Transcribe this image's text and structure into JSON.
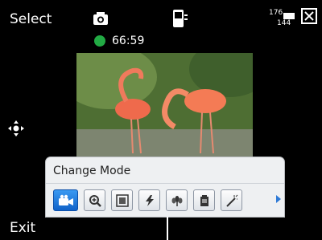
{
  "softkeys": {
    "left": "Select",
    "right": "Exit"
  },
  "status": {
    "recording_time": "66:59",
    "resolution_top": "176",
    "resolution_bottom": "144"
  },
  "menu": {
    "title": "Change Mode",
    "selected_index": 0,
    "items": [
      {
        "icon": "video-camera-icon"
      },
      {
        "icon": "zoom-icon"
      },
      {
        "icon": "frame-icon"
      },
      {
        "icon": "flash-icon"
      },
      {
        "icon": "macro-icon"
      },
      {
        "icon": "timer-icon"
      },
      {
        "icon": "effects-icon"
      }
    ]
  },
  "colors": {
    "record_dot": "#22aa44",
    "selection": "#1f7be0"
  }
}
